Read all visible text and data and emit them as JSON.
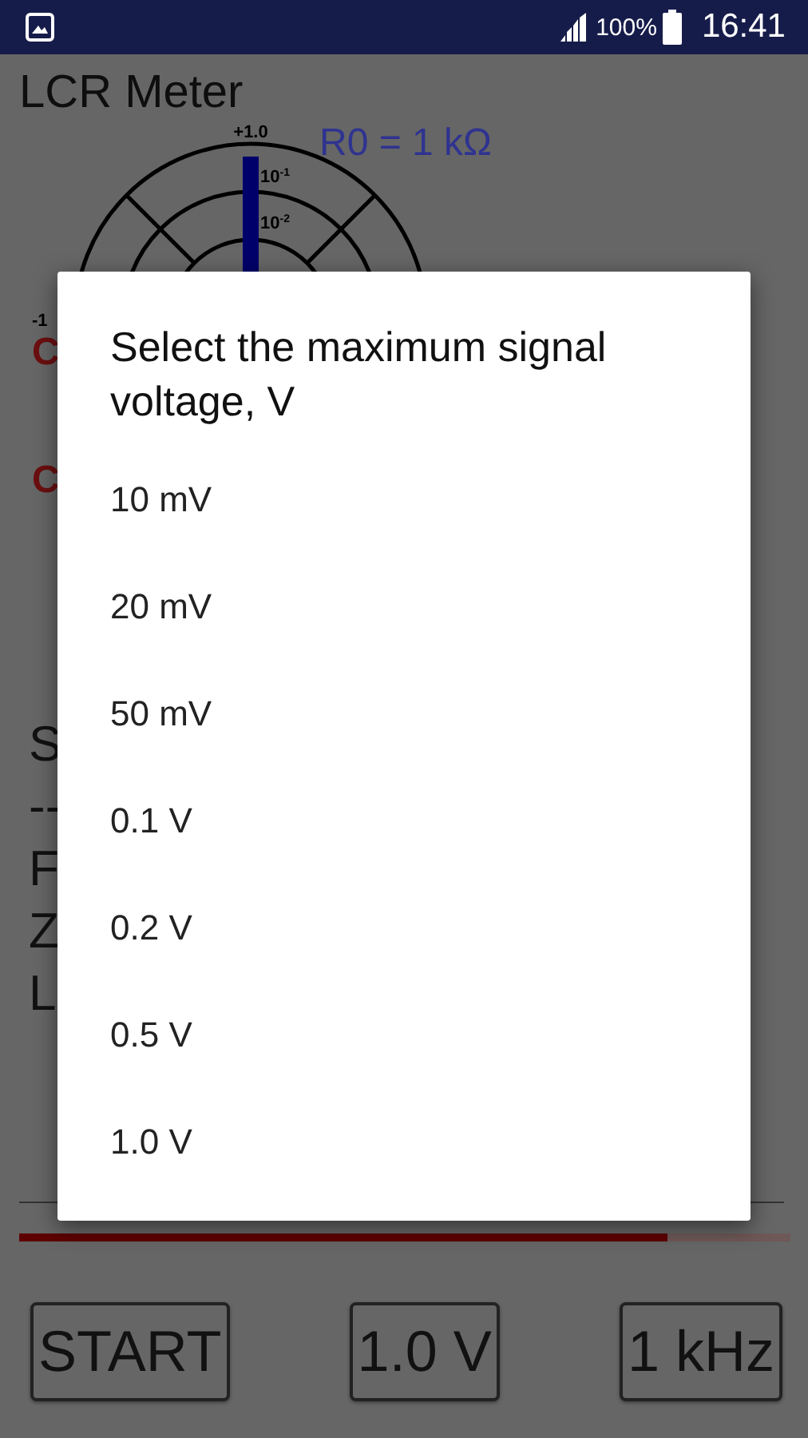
{
  "status_bar": {
    "battery": "100%",
    "time": "16:41"
  },
  "app": {
    "title": "LCR Meter",
    "r0": "R0 = 1 kΩ",
    "polar": {
      "top_label": "+1.0",
      "ring_labels": [
        {
          "base": "10",
          "exp": "-1"
        },
        {
          "base": "10",
          "exp": "-2"
        }
      ],
      "left_label": "-1"
    },
    "side_labels": [
      "C",
      "C"
    ],
    "readouts": [
      "S",
      "--",
      "F",
      "Z",
      "L"
    ],
    "progress": {
      "level": 0.84
    },
    "buttons": [
      "START",
      "1.0 V",
      "1 kHz"
    ]
  },
  "dialog": {
    "title": "Select the maximum signal voltage, V",
    "options": [
      "10 mV",
      "20 mV",
      "50 mV",
      "0.1 V",
      "0.2 V",
      "0.5 V",
      "1.0 V"
    ]
  }
}
